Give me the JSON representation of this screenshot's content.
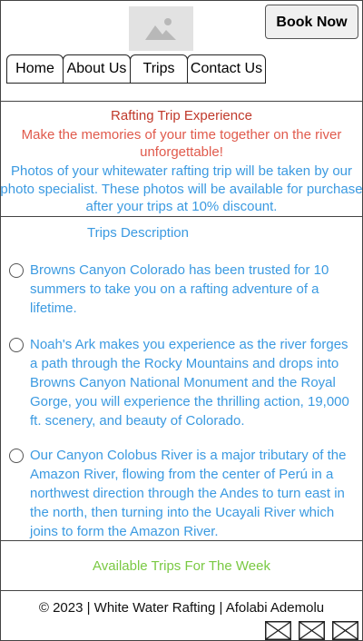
{
  "header": {
    "logo_icon": "image-placeholder-icon",
    "book_button": "Book Now",
    "nav": [
      "Home",
      "About Us",
      "Trips",
      "Contact Us"
    ]
  },
  "hero": {
    "title": "Rafting Trip Experience",
    "tagline": "Make the memories of your time together on the river unforgettable!",
    "description": "Photos of your whitewater rafting trip will be taken by our photo specialist. These photos will be available for purchase after your trips at 10% discount."
  },
  "trips": {
    "heading": "Trips Description",
    "items": [
      "Browns Canyon Colorado has been trusted for 10 summers to take you on a rafting adventure of a lifetime.",
      "Noah's Ark makes you experience as the river forges a path through the Rocky Mountains and drops into Browns Canyon National Monument and the Royal Gorge, you will experience the thrilling action, 19,000 ft. scenery, and beauty of Colorado.",
      "Our Canyon Colobus River is a major tributary of the Amazon River, flowing from the center of Perú in a northwest direction through the Andes to turn east in the north, then turning into the Ucayali River which joins to form the Amazon River."
    ]
  },
  "available": "Available Trips For The Week",
  "footer": {
    "text": "© 2023 | White Water Rafting | Afolabi Ademolu",
    "social_icons": [
      "broken-image-icon",
      "broken-image-icon",
      "broken-image-icon"
    ]
  },
  "colors": {
    "title_red": "#c0392b",
    "tagline_red": "#e05a4c",
    "text_blue": "#3b9ae1",
    "available_green": "#7ac943"
  }
}
